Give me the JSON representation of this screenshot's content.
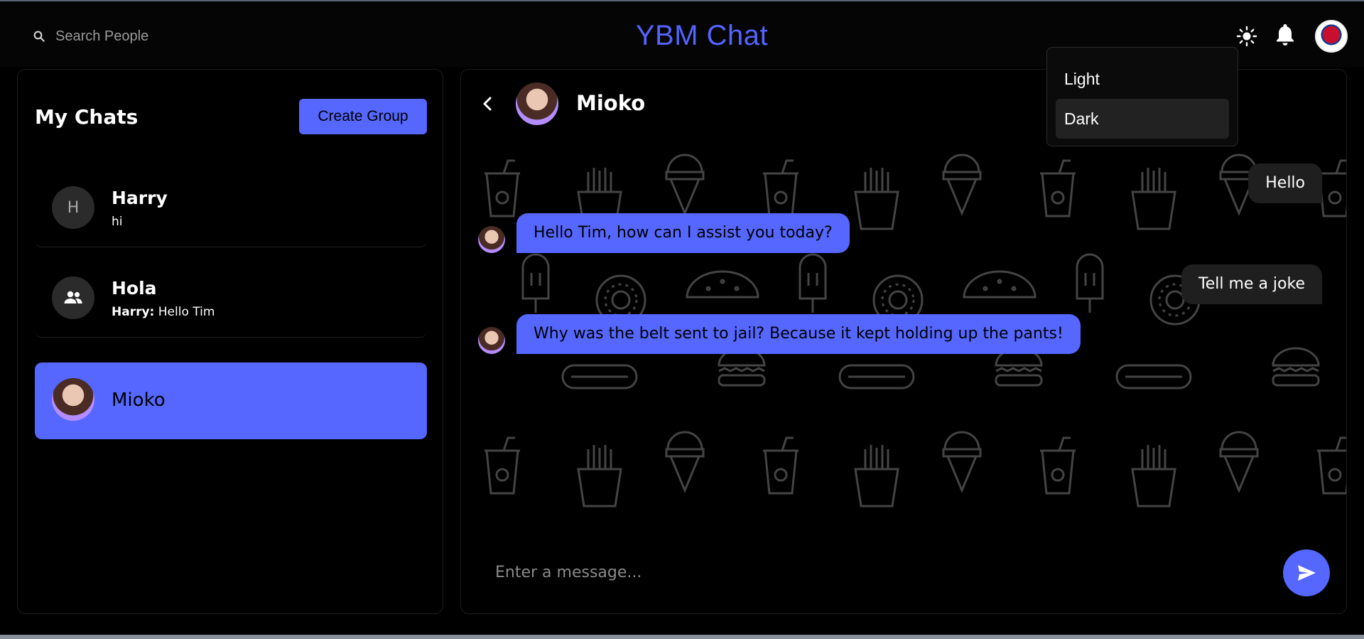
{
  "header": {
    "search_label": "Search People",
    "title": "YBM Chat",
    "icons": [
      "search-icon",
      "sun-icon",
      "bell-icon",
      "user-avatar"
    ]
  },
  "theme_menu": {
    "options": [
      "Light",
      "Dark"
    ],
    "selected": "Dark"
  },
  "sidebar": {
    "title": "My Chats",
    "create_group_label": "Create Group",
    "chats": [
      {
        "initial": "H",
        "name": "Harry",
        "preview_sender": "",
        "preview_text": "hi"
      },
      {
        "initial": "",
        "name": "Hola",
        "preview_sender": "Harry:",
        "preview_text": "Hello Tim",
        "icon": "group-icon"
      },
      {
        "initial": "",
        "name": "Mioko",
        "preview_sender": "",
        "preview_text": "",
        "selected": true
      }
    ]
  },
  "conversation": {
    "contact_name": "Mioko",
    "messages": [
      {
        "from": "me",
        "text": "Hello"
      },
      {
        "from": "Mioko",
        "text": "Hello Tim, how can I assist you today?"
      },
      {
        "from": "me",
        "text": "Tell me a joke"
      },
      {
        "from": "Mioko",
        "text": "Why was the belt sent to jail? Because it kept holding up the pants!"
      }
    ],
    "input_placeholder": "Enter a message..."
  },
  "colors": {
    "accent": "#5567ff",
    "background": "#000000",
    "sent_bubble": "#1f1f1f"
  }
}
